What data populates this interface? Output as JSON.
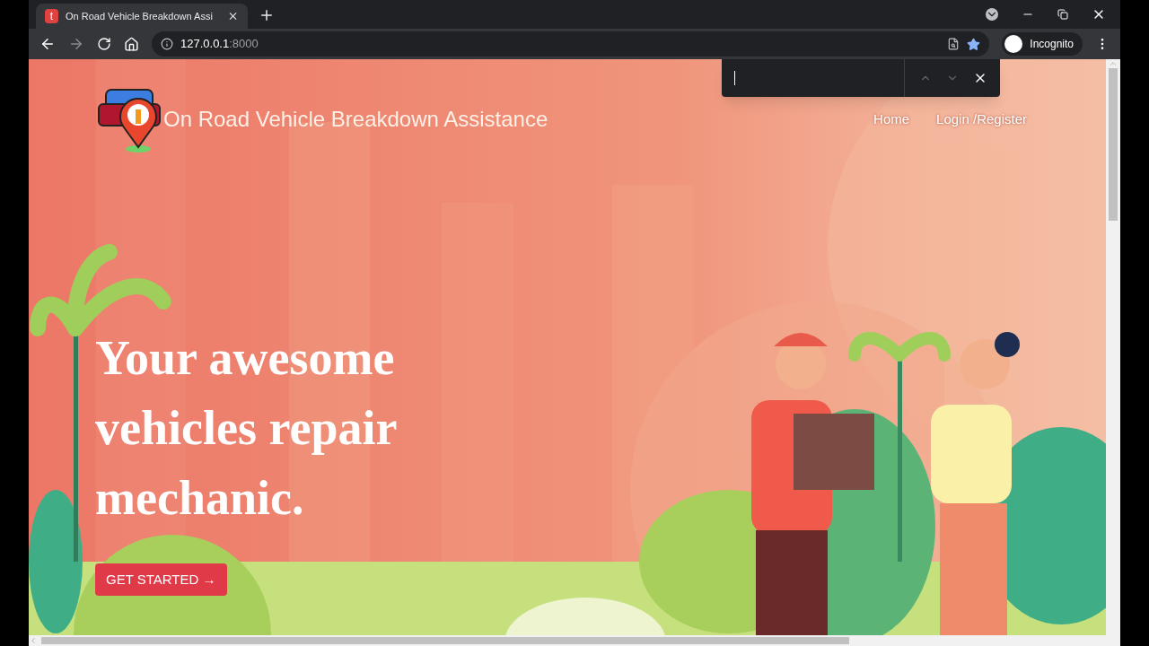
{
  "browser": {
    "tab": {
      "favicon": "t",
      "title": "On Road Vehicle Breakdown Assi"
    },
    "address": {
      "host": "127.0.0.1",
      "port": ":8000"
    },
    "profile": "Incognito"
  },
  "page": {
    "brand": "On Road Vehicle Breakdown Assistance",
    "nav_links": [
      "Home",
      "Login /Register"
    ],
    "hero_heading": "Your awesome vehicles repair mechanic.",
    "cta_button": "GET STARTED →"
  }
}
